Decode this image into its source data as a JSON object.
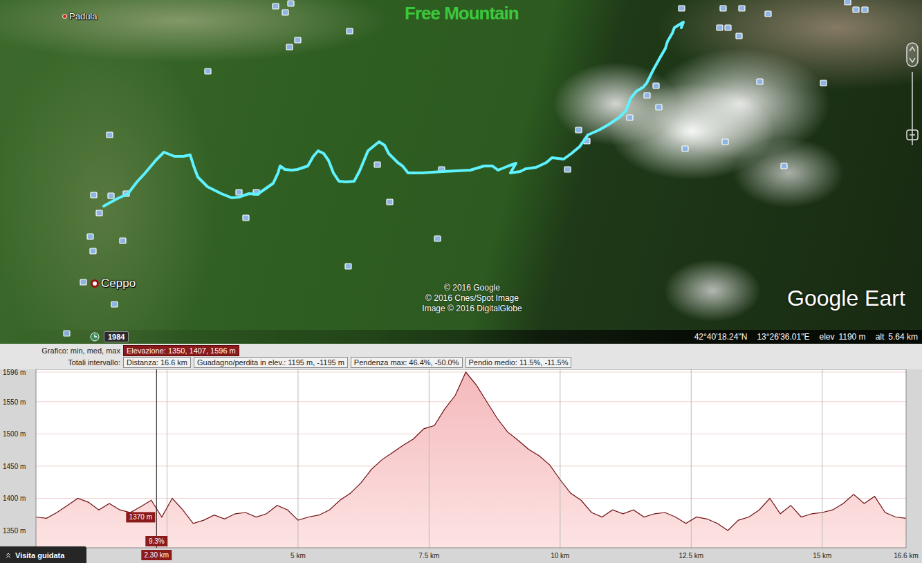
{
  "map": {
    "labels": [
      {
        "text": "Padula",
        "kind": "dot"
      },
      {
        "text": "Ceppo",
        "kind": "pin"
      }
    ],
    "watermark": "Free Mountain",
    "attribution": [
      "© 2016 Google",
      "© 2016 Cnes/Spot Image",
      "Image © 2016 DigitalGlobe"
    ],
    "logo": "Google Eart"
  },
  "status_bar": {
    "year": "1984",
    "lat": "42°40'18.24\"N",
    "lon": "13°26'36.01\"E",
    "elev_label": "elev",
    "elev": "1190 m",
    "alt_label": "alt",
    "alt": "5.64 km"
  },
  "profile": {
    "rows": [
      {
        "label": "Grafico: min, med, max",
        "items": [
          {
            "text": "Elevazione: 1350, 1407, 1596 m",
            "selected": true
          }
        ]
      },
      {
        "label": "Totali intervallo:",
        "items": [
          {
            "text": "Distanza: 16.6 km",
            "selected": false
          },
          {
            "text": "Guadagno/perdita in elev.: 1195 m, -1195 m",
            "selected": false
          },
          {
            "text": "Pendenza max: 46.4%, -50.0%",
            "selected": false
          },
          {
            "text": "Pendio medio: 11.5%, -11.5%",
            "selected": false
          }
        ]
      }
    ],
    "y_ticks": [
      {
        "value": 1596,
        "label": "1596 m"
      },
      {
        "value": 1550,
        "label": "1550 m"
      },
      {
        "value": 1500,
        "label": "1500 m"
      },
      {
        "value": 1450,
        "label": "1450 m"
      },
      {
        "value": 1400,
        "label": "1400 m"
      },
      {
        "value": 1350,
        "label": "1350 m"
      }
    ],
    "x_ticks": [
      {
        "value": 5,
        "label": "5 km"
      },
      {
        "value": 7.5,
        "label": "7.5 km"
      },
      {
        "value": 10,
        "label": "10 km"
      },
      {
        "value": 12.5,
        "label": "12.5 km"
      },
      {
        "value": 15,
        "label": "15 km"
      },
      {
        "value": 16.6,
        "label": "16.6 km"
      }
    ],
    "cursor": {
      "km": 2.3,
      "elevation": "1370 m",
      "grade": "9.3%",
      "distance": "2.30 km"
    },
    "series": [
      {
        "values": [
          1371,
          1369,
          1378,
          1389,
          1400,
          1394,
          1382,
          1392,
          1382,
          1378,
          1387,
          1397,
          1371,
          1400,
          1382,
          1361,
          1366,
          1374,
          1368,
          1376,
          1378,
          1371,
          1376,
          1389,
          1382,
          1366,
          1371,
          1374,
          1382,
          1397,
          1408,
          1424,
          1445,
          1460,
          1471,
          1482,
          1492,
          1508,
          1513,
          1539,
          1560,
          1596,
          1576,
          1550,
          1524,
          1503,
          1490,
          1476,
          1466,
          1452,
          1429,
          1408,
          1397,
          1378,
          1371,
          1382,
          1376,
          1382,
          1371,
          1376,
          1378,
          1371,
          1361,
          1371,
          1368,
          1361,
          1350,
          1366,
          1371,
          1382,
          1400,
          1376,
          1389,
          1371,
          1376,
          1378,
          1382,
          1392,
          1406,
          1392,
          1403,
          1378,
          1371,
          1369
        ]
      }
    ]
  },
  "tour_button": "Visita guidata"
}
